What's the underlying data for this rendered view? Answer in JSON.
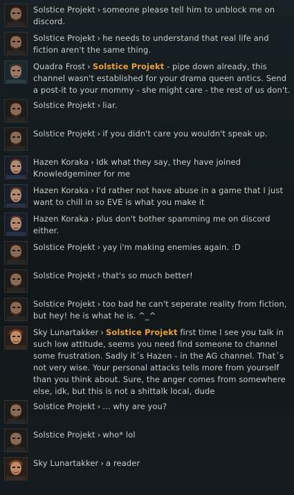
{
  "colors": {
    "background": "#141a1e",
    "text": "#c9cdc9",
    "mention": "#e6a03a"
  },
  "separator": "›",
  "messages": [
    {
      "sender": "Solstice Projekt",
      "avatar": "solstice",
      "mention": "",
      "text": "someone please tell him to unblock me on discord."
    },
    {
      "sender": "Solstice Projekt",
      "avatar": "solstice",
      "mention": "",
      "text": "he needs to understand that real life and fiction aren't the same thing."
    },
    {
      "sender": "Quadra Frost",
      "avatar": "quadra",
      "mention": "Solstice Projekt",
      "text": " - pipe down already, this channel wasn't established for your drama queen antics. Send a post-it to your mommy - she might care - the rest of us don't."
    },
    {
      "sender": "Solstice Projekt",
      "avatar": "solstice",
      "mention": "",
      "text": "liar."
    },
    {
      "sender": "Solstice Projekt",
      "avatar": "solstice",
      "mention": "",
      "text": "if you didn't care you wouldn't speak up."
    },
    {
      "sender": "Hazen Koraka",
      "avatar": "hazen",
      "mention": "",
      "text": "Idk what they say, they have joined Knowledgeminer for me"
    },
    {
      "sender": "Hazen Koraka",
      "avatar": "hazen",
      "mention": "",
      "text": "I'd rather not have abuse in a game that I just want to chill in so EVE is what you make it"
    },
    {
      "sender": "Hazen Koraka",
      "avatar": "hazen",
      "mention": "",
      "text": "plus don't bother spamming me on discord either."
    },
    {
      "sender": "Solstice Projekt",
      "avatar": "solstice",
      "mention": "",
      "text": "yay i'm making enemies again. :D"
    },
    {
      "sender": "Solstice Projekt",
      "avatar": "solstice",
      "mention": "",
      "text": "that's so much better!"
    },
    {
      "sender": "Solstice Projekt",
      "avatar": "solstice",
      "mention": "",
      "text": "too bad he can't seperate reality from fiction, but hey! he is what he is. ^_^"
    },
    {
      "sender": "Sky Lunartakker",
      "avatar": "sky",
      "mention": "Solstice Projekt",
      "text": " first time I see you talk in such low attitude, seems you need find someone to channel some frustration. Sadly it´s Hazen - in the AG channel. That´s not very wise. Your personal attacks tells more from yourself than you think about. Sure, the anger comes from somewhere else, idk, but this is not a shittalk local, dude"
    },
    {
      "sender": "Solstice Projekt",
      "avatar": "solstice",
      "mention": "",
      "text": "... why are you?"
    },
    {
      "sender": "Solstice Projekt",
      "avatar": "solstice",
      "mention": "",
      "text": "who* lol"
    },
    {
      "sender": "Sky Lunartakker",
      "avatar": "sky",
      "mention": "",
      "text": "a reader"
    }
  ]
}
